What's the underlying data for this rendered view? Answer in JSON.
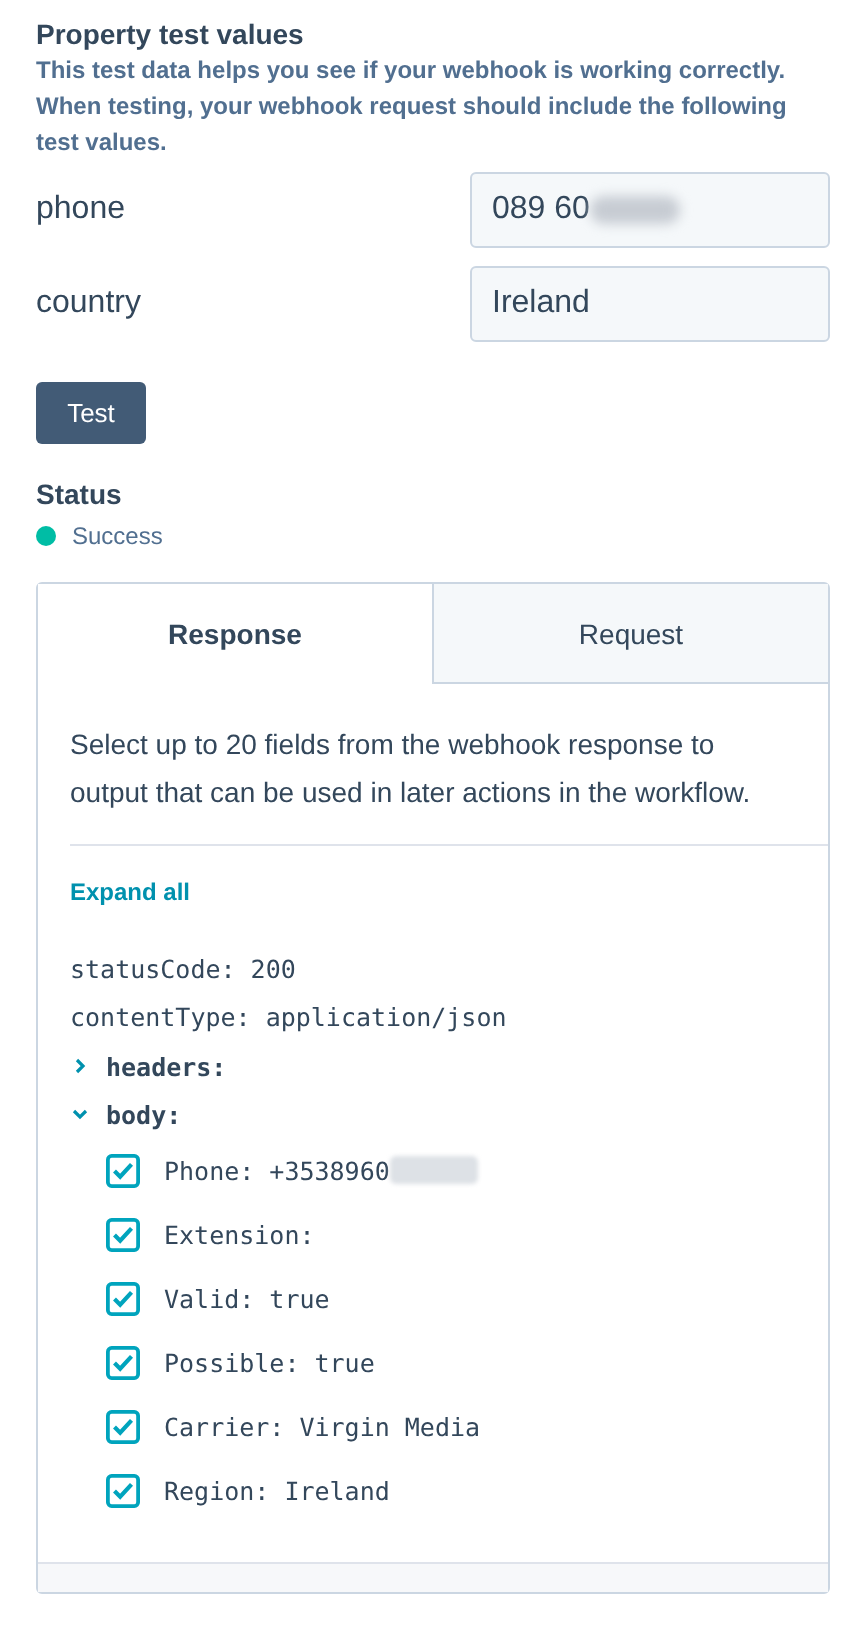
{
  "section": {
    "title": "Property test values",
    "description": "This test data helps you see if your webhook is working correctly. When testing, your webhook request should include the following test values."
  },
  "properties": [
    {
      "label": "phone",
      "value": "089 60",
      "redacted": true
    },
    {
      "label": "country",
      "value": "Ireland",
      "redacted": false
    }
  ],
  "test_button": "Test",
  "status": {
    "heading": "Status",
    "text": "Success",
    "color": "#00bda5"
  },
  "tabs": [
    {
      "label": "Response",
      "selected": true
    },
    {
      "label": "Request",
      "selected": false
    }
  ],
  "response": {
    "description": "Select up to 20 fields from the webhook response to output that can be used in later actions in the workflow.",
    "expand_all": "Expand all",
    "tree": [
      {
        "kind": "plain",
        "text": "statusCode: 200"
      },
      {
        "kind": "plain",
        "text": "contentType: application/json"
      },
      {
        "kind": "group",
        "text": "headers:",
        "expanded": false
      },
      {
        "kind": "group",
        "text": "body:",
        "expanded": true,
        "children": [
          {
            "text": "Phone: +3538960",
            "checked": true,
            "redacted": true
          },
          {
            "text": "Extension:",
            "checked": true,
            "redacted": false
          },
          {
            "text": "Valid: true",
            "checked": true,
            "redacted": false
          },
          {
            "text": "Possible: true",
            "checked": true,
            "redacted": false
          },
          {
            "text": "Carrier: Virgin Media",
            "checked": true,
            "redacted": false
          },
          {
            "text": "Region: Ireland",
            "checked": true,
            "redacted": false
          }
        ]
      }
    ]
  }
}
